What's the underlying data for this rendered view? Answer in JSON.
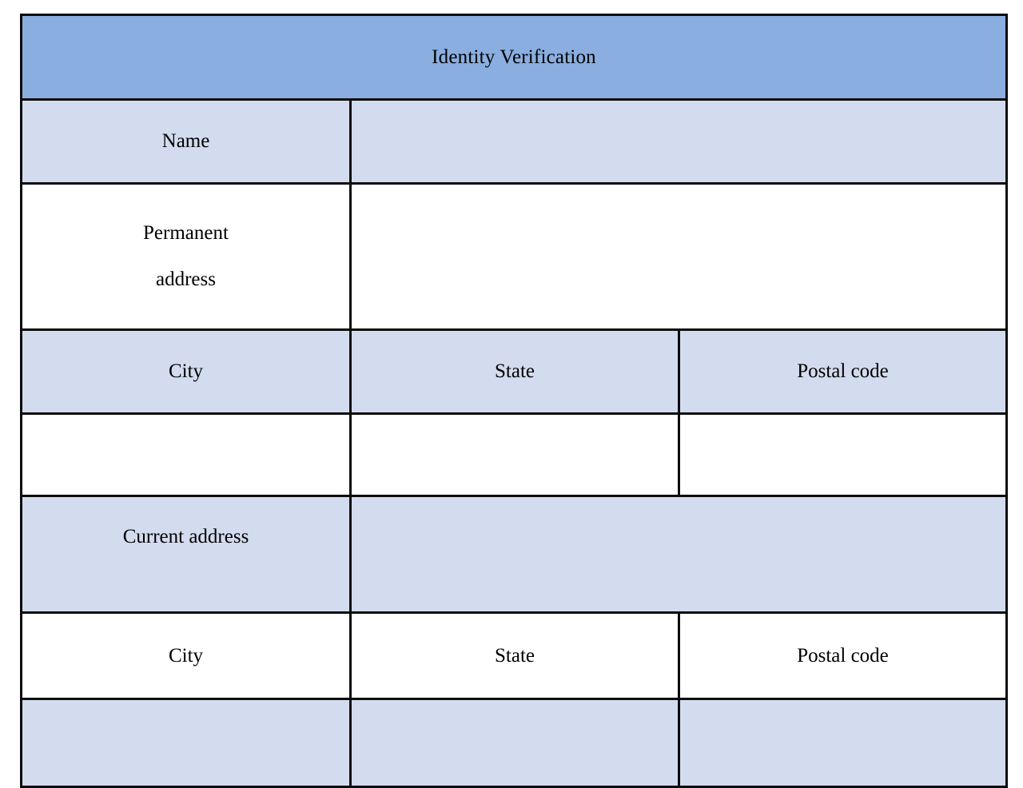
{
  "document": {
    "title": "Identity Verification"
  },
  "colors": {
    "header_fill": "#8AAEE0",
    "cell_fill": "#D3DCEE",
    "empty_fill": "#FFFFFF",
    "border": "#0B0B0B",
    "text": "#000000"
  },
  "labels": {
    "name": "Name",
    "permanent_address_line1": "Permanent",
    "permanent_address_line2": "address",
    "city": "City",
    "state": "State",
    "postal_code": "Postal code",
    "current_address": "Current address"
  },
  "fields": {
    "name_value": "",
    "permanent_address_value": "",
    "permanent_city_value": "",
    "permanent_state_value": "",
    "permanent_postal_code_value": "",
    "current_address_value": "",
    "current_city_value": "",
    "current_state_value": "",
    "current_postal_code_value": ""
  },
  "rows": [
    {
      "id": "title",
      "fill": "header",
      "cells": [
        "Identity Verification"
      ]
    },
    {
      "id": "name",
      "fill": "blue",
      "cells": [
        "Name",
        ""
      ]
    },
    {
      "id": "permanent",
      "fill": "white",
      "cells": [
        "Permanent address",
        ""
      ]
    },
    {
      "id": "perm-labels",
      "fill": "blue",
      "cells": [
        "City",
        "State",
        "Postal code"
      ]
    },
    {
      "id": "perm-values",
      "fill": "white",
      "cells": [
        "",
        "",
        ""
      ]
    },
    {
      "id": "current",
      "fill": "blue",
      "cells": [
        "Current address",
        ""
      ]
    },
    {
      "id": "current-labels",
      "fill": "white",
      "cells": [
        "City",
        "State",
        "Postal code"
      ]
    },
    {
      "id": "current-values",
      "fill": "blue",
      "cells": [
        "",
        "",
        ""
      ]
    }
  ]
}
